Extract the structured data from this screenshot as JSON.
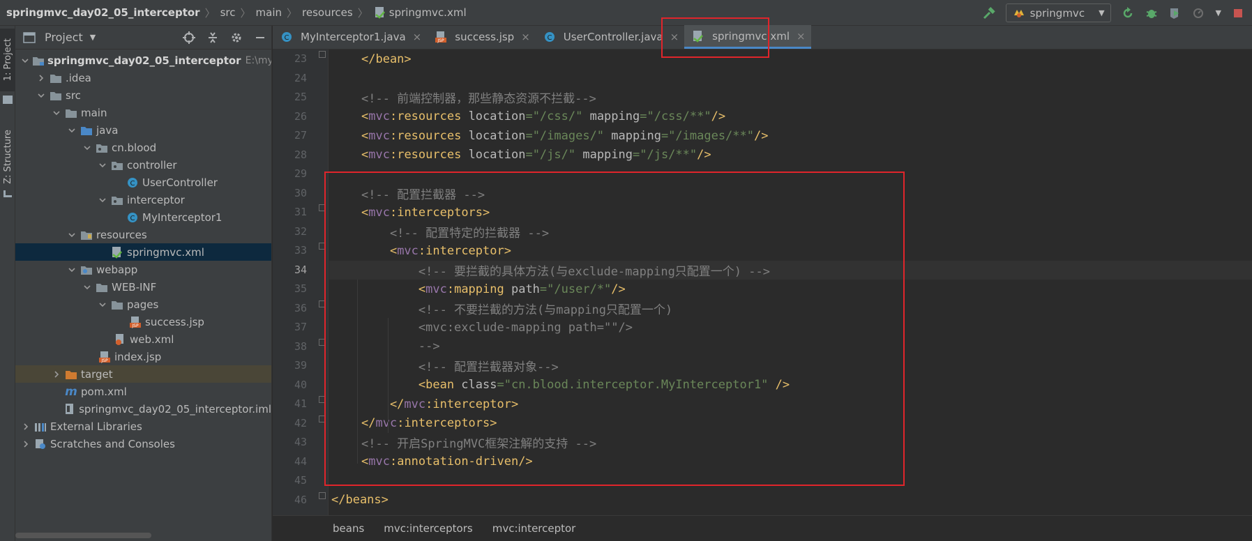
{
  "breadcrumb": {
    "items": [
      "springmvc_day02_05_interceptor",
      "src",
      "main",
      "resources",
      "springmvc.xml"
    ]
  },
  "toolbar": {
    "run_config": "springmvc"
  },
  "toolstrip": {
    "project_tab": "1: Project",
    "structure_tab": "Z: Structure"
  },
  "project_panel": {
    "title": "Project",
    "root_label": "springmvc_day02_05_interceptor",
    "root_path": "E:\\myWo",
    "nodes": {
      "idea": ".idea",
      "src": "src",
      "main": "main",
      "java": "java",
      "pkg": "cn.blood",
      "controller": "controller",
      "user_controller": "UserController",
      "interceptor": "interceptor",
      "my_interceptor": "MyInterceptor1",
      "resources": "resources",
      "springmvc_xml": "springmvc.xml",
      "webapp": "webapp",
      "webinf": "WEB-INF",
      "pages": "pages",
      "success_jsp": "success.jsp",
      "web_xml": "web.xml",
      "index_jsp": "index.jsp",
      "target": "target",
      "pom": "pom.xml",
      "iml": "springmvc_day02_05_interceptor.iml",
      "ext_libs": "External Libraries",
      "scratches": "Scratches and Consoles"
    }
  },
  "editor": {
    "tabs": [
      {
        "label": "MyInterceptor1.java",
        "active": false
      },
      {
        "label": "success.jsp",
        "active": false
      },
      {
        "label": "UserController.java",
        "active": false
      },
      {
        "label": "springmvc.xml",
        "active": true
      }
    ],
    "current_line": "34",
    "lines": [
      {
        "n": "23",
        "tokens": [
          [
            "tag",
            "</bean>"
          ]
        ]
      },
      {
        "n": "24",
        "tokens": []
      },
      {
        "n": "25",
        "tokens": [
          [
            "com",
            "<!-- 前端控制器，那些静态资源不拦截-->"
          ]
        ]
      },
      {
        "n": "26",
        "tokens": [
          [
            "tag",
            "<"
          ],
          [
            "ns",
            "mvc"
          ],
          [
            "tag",
            ":resources "
          ],
          [
            "attr",
            "location"
          ],
          [
            "str",
            "=\"/css/\" "
          ],
          [
            "attr",
            "mapping"
          ],
          [
            "str",
            "=\"/css/**\""
          ],
          [
            "tag",
            "/>"
          ]
        ]
      },
      {
        "n": "27",
        "tokens": [
          [
            "tag",
            "<"
          ],
          [
            "ns",
            "mvc"
          ],
          [
            "tag",
            ":resources "
          ],
          [
            "attr",
            "location"
          ],
          [
            "str",
            "=\"/images/\" "
          ],
          [
            "attr",
            "mapping"
          ],
          [
            "str",
            "=\"/images/**\""
          ],
          [
            "tag",
            "/>"
          ]
        ]
      },
      {
        "n": "28",
        "tokens": [
          [
            "tag",
            "<"
          ],
          [
            "ns",
            "mvc"
          ],
          [
            "tag",
            ":resources "
          ],
          [
            "attr",
            "location"
          ],
          [
            "str",
            "=\"/js/\" "
          ],
          [
            "attr",
            "mapping"
          ],
          [
            "str",
            "=\"/js/**\""
          ],
          [
            "tag",
            "/>"
          ]
        ]
      },
      {
        "n": "29",
        "tokens": []
      },
      {
        "n": "30",
        "tokens": [
          [
            "com",
            "<!-- 配置拦截器 -->"
          ]
        ]
      },
      {
        "n": "31",
        "tokens": [
          [
            "tag",
            "<"
          ],
          [
            "ns",
            "mvc"
          ],
          [
            "tag",
            ":interceptors>"
          ]
        ]
      },
      {
        "n": "32",
        "tokens": [
          [
            "com",
            "    <!-- 配置特定的拦截器 -->"
          ]
        ]
      },
      {
        "n": "33",
        "tokens": [
          [
            "tag",
            "    <"
          ],
          [
            "ns",
            "mvc"
          ],
          [
            "tag",
            ":interceptor>"
          ]
        ]
      },
      {
        "n": "34",
        "tokens": [
          [
            "com",
            "        <!-- 要拦截的具体方法(与exclude-mapping只配置一个) -->"
          ]
        ]
      },
      {
        "n": "35",
        "tokens": [
          [
            "tag",
            "        <"
          ],
          [
            "ns",
            "mvc"
          ],
          [
            "tag",
            ":mapping "
          ],
          [
            "attr",
            "path"
          ],
          [
            "str",
            "=\"/user/*\""
          ],
          [
            "tag",
            "/>"
          ]
        ]
      },
      {
        "n": "36",
        "tokens": [
          [
            "com",
            "        <!-- 不要拦截的方法(与mapping只配置一个)"
          ]
        ]
      },
      {
        "n": "37",
        "tokens": [
          [
            "com",
            "        <mvc:exclude-mapping path=\"\"/>"
          ]
        ]
      },
      {
        "n": "38",
        "tokens": [
          [
            "com",
            "        -->"
          ]
        ]
      },
      {
        "n": "39",
        "tokens": [
          [
            "com",
            "        <!-- 配置拦截器对象-->"
          ]
        ]
      },
      {
        "n": "40",
        "tokens": [
          [
            "tag",
            "        <bean "
          ],
          [
            "attr",
            "class"
          ],
          [
            "str",
            "=\"cn.blood.interceptor.MyInterceptor1\" "
          ],
          [
            "tag",
            "/>"
          ]
        ]
      },
      {
        "n": "41",
        "tokens": [
          [
            "tag",
            "    </"
          ],
          [
            "ns",
            "mvc"
          ],
          [
            "tag",
            ":interceptor>"
          ]
        ]
      },
      {
        "n": "42",
        "tokens": [
          [
            "tag",
            "</"
          ],
          [
            "ns",
            "mvc"
          ],
          [
            "tag",
            ":interceptors>"
          ]
        ]
      },
      {
        "n": "43",
        "tokens": [
          [
            "com",
            "<!-- 开启SpringMVC框架注解的支持 -->"
          ]
        ]
      },
      {
        "n": "44",
        "tokens": [
          [
            "tag",
            "<"
          ],
          [
            "ns",
            "mvc"
          ],
          [
            "tag",
            ":annotation-driven/>"
          ]
        ]
      },
      {
        "n": "45",
        "tokens": []
      },
      {
        "n": "46",
        "tokens": [
          [
            "tag",
            "</beans>"
          ]
        ]
      }
    ],
    "status_path": [
      "beans",
      "mvc:interceptors",
      "mvc:interceptor"
    ]
  }
}
